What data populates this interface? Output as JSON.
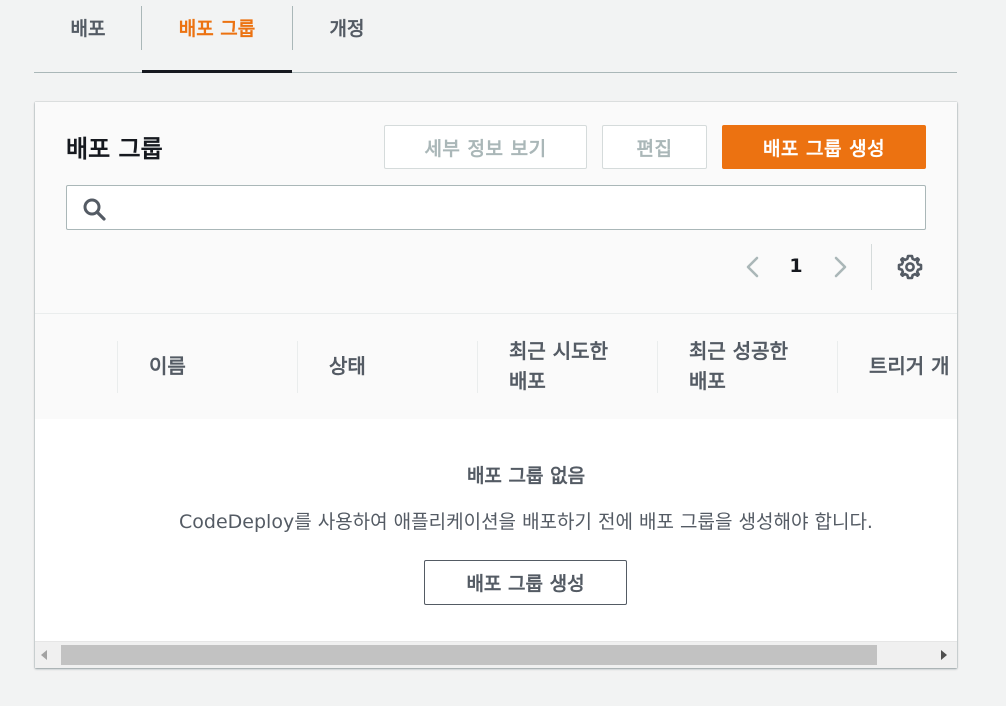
{
  "tabs": [
    {
      "label": "배포",
      "active": false
    },
    {
      "label": "배포 그룹",
      "active": true
    },
    {
      "label": "개정",
      "active": false
    }
  ],
  "panel": {
    "title": "배포 그룹",
    "buttons": {
      "view_details": "세부 정보 보기",
      "edit": "편집",
      "create": "배포 그룹 생성"
    },
    "search": {
      "placeholder": "",
      "value": ""
    },
    "pagination": {
      "current_page": "1"
    }
  },
  "table": {
    "columns": [
      {
        "line1": "이름",
        "line2": ""
      },
      {
        "line1": "상태",
        "line2": ""
      },
      {
        "line1": "최근 시도한",
        "line2": "배포"
      },
      {
        "line1": "최근 성공한",
        "line2": "배포"
      },
      {
        "line1": "트리거 개",
        "line2": ""
      }
    ],
    "empty": {
      "title": "배포 그룹 없음",
      "description": "CodeDeploy를 사용하여 애플리케이션을 배포하기 전에 배포 그룹을 생성해야 합니다.",
      "button": "배포 그룹 생성"
    }
  },
  "colors": {
    "accent": "#ec7211",
    "text": "#16191f",
    "muted": "#545b64",
    "disabled": "#aab7b8"
  },
  "icons": [
    "search-icon",
    "chevron-left-icon",
    "chevron-right-icon",
    "gear-icon",
    "scroll-left-arrow-icon",
    "scroll-right-arrow-icon"
  ]
}
